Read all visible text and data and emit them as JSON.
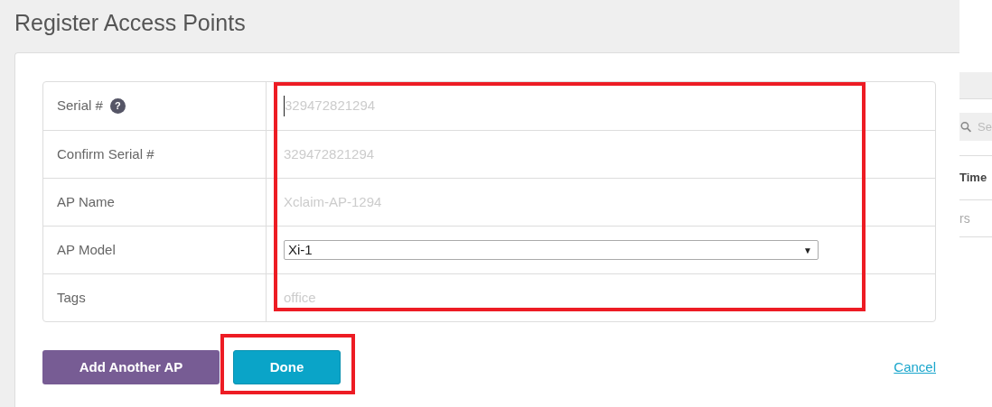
{
  "dialog": {
    "title": "Register Access Points",
    "fields": [
      {
        "kind": "text",
        "label": "Serial #",
        "help": "?",
        "placeholder": "329472821294",
        "focused": true
      },
      {
        "kind": "text",
        "label": "Confirm Serial #",
        "placeholder": "329472821294",
        "focused": false
      },
      {
        "kind": "text",
        "label": "AP Name",
        "placeholder": "Xclaim-AP-1294",
        "focused": false
      },
      {
        "kind": "select",
        "label": "AP Model",
        "value": "Xi-1",
        "caret": "▼"
      },
      {
        "kind": "text",
        "label": "Tags",
        "placeholder": "office",
        "focused": false
      }
    ],
    "buttons": [
      {
        "kind": "secondary",
        "label": "Add Another AP",
        "highlighted": false
      },
      {
        "kind": "primary",
        "label": "Done",
        "highlighted": true
      }
    ],
    "cancel": "Cancel"
  },
  "background_page": {
    "search": {
      "placeholder": "Se"
    },
    "column_header": "Time",
    "cell": "rs"
  }
}
